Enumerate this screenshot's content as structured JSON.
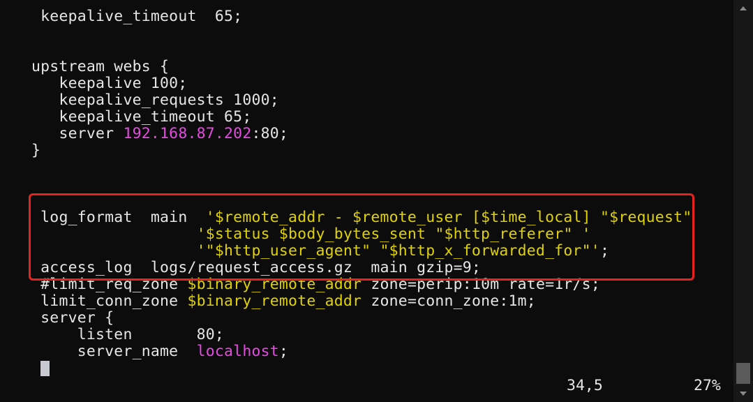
{
  "editor": {
    "lines": [
      {
        "indent": " ",
        "tokens": [
          {
            "t": "keepalive_timeout  65;",
            "c": "default"
          }
        ]
      },
      {
        "indent": "",
        "tokens": []
      },
      {
        "indent": "",
        "tokens": []
      },
      {
        "indent": "",
        "tokens": [
          {
            "t": "upstream webs {",
            "c": "default"
          }
        ]
      },
      {
        "indent": "   ",
        "tokens": [
          {
            "t": "keepalive 100;",
            "c": "default"
          }
        ]
      },
      {
        "indent": "   ",
        "tokens": [
          {
            "t": "keepalive_requests 1000;",
            "c": "default"
          }
        ]
      },
      {
        "indent": "   ",
        "tokens": [
          {
            "t": "keepalive_timeout 65;",
            "c": "default"
          }
        ]
      },
      {
        "indent": "   ",
        "tokens": [
          {
            "t": "server ",
            "c": "default"
          },
          {
            "t": "192.168.87.202",
            "c": "number"
          },
          {
            "t": ":80;",
            "c": "default"
          }
        ]
      },
      {
        "indent": "",
        "tokens": [
          {
            "t": "}",
            "c": "default"
          }
        ]
      },
      {
        "indent": "",
        "tokens": []
      },
      {
        "indent": "",
        "tokens": []
      },
      {
        "indent": "",
        "tokens": []
      },
      {
        "indent": " ",
        "tokens": [
          {
            "t": "log_format  main  ",
            "c": "default"
          },
          {
            "t": "'$remote_addr - $remote_user [$time_local] \"$request\"",
            "c": "string"
          }
        ]
      },
      {
        "indent": "                  ",
        "tokens": [
          {
            "t": "'$status $body_bytes_sent \"$http_referer\" '",
            "c": "string"
          }
        ]
      },
      {
        "indent": "                  ",
        "tokens": [
          {
            "t": "'\"$http_user_agent\" \"$http_x_forwarded_for\"'",
            "c": "string"
          },
          {
            "t": ";",
            "c": "default"
          }
        ]
      },
      {
        "indent": " ",
        "tokens": [
          {
            "t": "access_log  logs/request_access.gz  main gzip=9;",
            "c": "default"
          }
        ]
      },
      {
        "indent": " ",
        "tokens": [
          {
            "t": "#limit_req_zone ",
            "c": "default"
          },
          {
            "t": "$binary_remote_addr",
            "c": "string"
          },
          {
            "t": " zone=perip:10m rate=1r/s;",
            "c": "default"
          }
        ]
      },
      {
        "indent": " ",
        "tokens": [
          {
            "t": "limit_conn_zone ",
            "c": "default"
          },
          {
            "t": "$binary_remote_addr",
            "c": "string"
          },
          {
            "t": " zone=conn_zone:1m;",
            "c": "default"
          }
        ]
      },
      {
        "indent": " ",
        "tokens": [
          {
            "t": "server {",
            "c": "default"
          }
        ]
      },
      {
        "indent": "     ",
        "tokens": [
          {
            "t": "listen       80;",
            "c": "default"
          }
        ]
      },
      {
        "indent": "     ",
        "tokens": [
          {
            "t": "server_name  ",
            "c": "default"
          },
          {
            "t": "localhost",
            "c": "ident"
          },
          {
            "t": ";",
            "c": "default"
          }
        ]
      }
    ]
  },
  "status": {
    "position": "34,5",
    "percent": "27%"
  },
  "colors": {
    "background": "#0c0c0c",
    "text": "#e6e6e6",
    "string": "#e1d300",
    "number": "#e44ce0",
    "highlight_border": "#e8231f"
  }
}
